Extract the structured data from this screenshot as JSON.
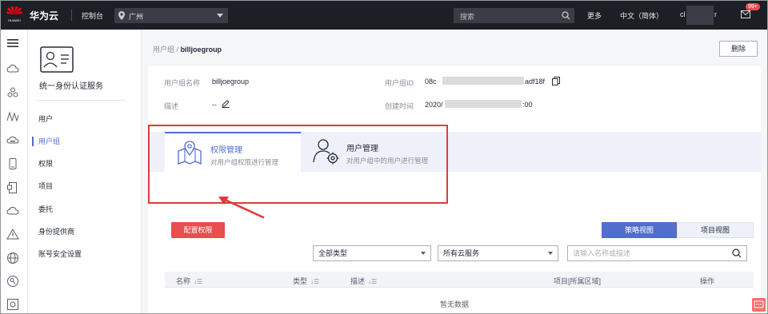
{
  "topbar": {
    "logo_text": "HUAWEI",
    "brand": "华为云",
    "console": "控制台",
    "region": "广州",
    "search_placeholder": "搜索",
    "more": "更多",
    "language": "中文（简体）",
    "username": "cl",
    "username_tail": "r",
    "badge": "99+"
  },
  "sidebar": {
    "service_title": "统一身份认证服务",
    "items": [
      "用户",
      "用户组",
      "权限",
      "项目",
      "委托",
      "身份提供商",
      "账号安全设置"
    ],
    "active_item": "用户组"
  },
  "breadcrumb": {
    "parent": "用户组",
    "separator": "/",
    "current": "billjoegroup"
  },
  "delete_button": "删除",
  "group_info": {
    "name_label": "用户组名称",
    "name_value": "billjoegroup",
    "id_label": "用户组ID",
    "id_prefix": "08c",
    "id_suffix": "adf18f",
    "desc_label": "描述",
    "desc_value": "--",
    "created_label": "创建时间",
    "created_prefix": "2020/",
    "created_suffix": ":00"
  },
  "tabs": [
    {
      "title": "权限管理",
      "subtitle": "对用户组权限进行管理",
      "selected": true
    },
    {
      "title": "用户管理",
      "subtitle": "对用户组中的用户进行管理",
      "selected": false
    }
  ],
  "config_button": "配置权限",
  "views": {
    "policy": "策略视图",
    "project": "项目视图",
    "active": "策略视图"
  },
  "filters": {
    "type_select": "全部类型",
    "service_select": "所有云服务",
    "search_placeholder": "请输入名称或描述"
  },
  "table": {
    "columns": [
      "名称",
      "类型",
      "描述",
      "项目[所属区域]",
      "操作"
    ],
    "empty_text": "暂无数据"
  },
  "colors": {
    "accent": "#526ecc",
    "danger": "#e84e4e",
    "annotation": "#e03a3a",
    "topbar": "#1d1f26"
  },
  "icons": {
    "rail": [
      "menu-icon",
      "cloud-icon",
      "cluster-icon",
      "chart-icon",
      "cloud-server-icon",
      "phone-icon",
      "doc-icon",
      "cloud-icon",
      "warning-icon",
      "globe-icon",
      "key-icon",
      "settings-icon"
    ]
  }
}
